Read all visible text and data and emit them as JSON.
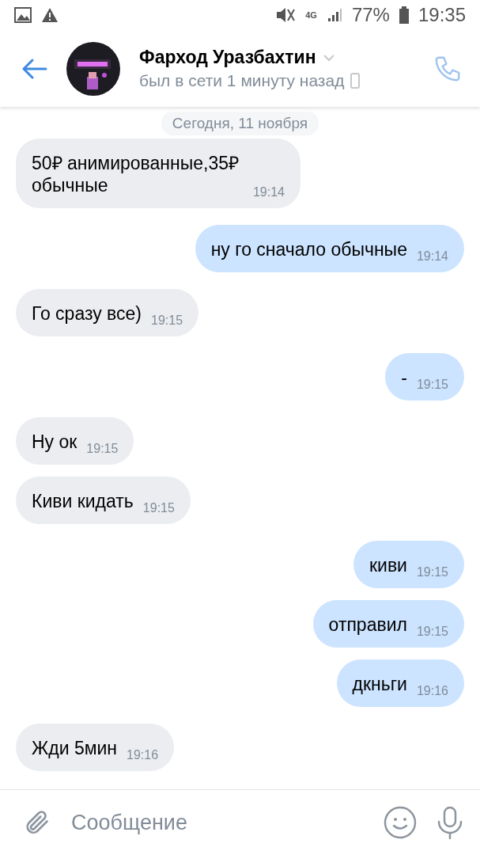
{
  "status_bar": {
    "battery": "77%",
    "time": "19:35",
    "network": "4G"
  },
  "header": {
    "name": "Фарход Уразбахтин",
    "status": "был в сети 1 минуту назад"
  },
  "date_chip": "Сегодня, 11 ноября",
  "messages": [
    {
      "outgoing": false,
      "text": "50₽ анимированные,35₽ обычные",
      "time": "19:14"
    },
    {
      "outgoing": true,
      "text": "ну го сначало обычные",
      "time": "19:14"
    },
    {
      "outgoing": false,
      "text": "Го сразу все)",
      "time": "19:15"
    },
    {
      "outgoing": true,
      "text": "-",
      "time": "19:15"
    },
    {
      "outgoing": false,
      "text": "Ну ок",
      "time": "19:15"
    },
    {
      "outgoing": false,
      "text": "Киви кидать",
      "time": "19:15"
    },
    {
      "outgoing": true,
      "text": "киви",
      "time": "19:15"
    },
    {
      "outgoing": true,
      "text": "отправил",
      "time": "19:15"
    },
    {
      "outgoing": true,
      "text": "дкньги",
      "time": "19:16"
    },
    {
      "outgoing": false,
      "text": "Жди 5мин",
      "time": "19:16"
    }
  ],
  "composer": {
    "placeholder": "Сообщение"
  }
}
